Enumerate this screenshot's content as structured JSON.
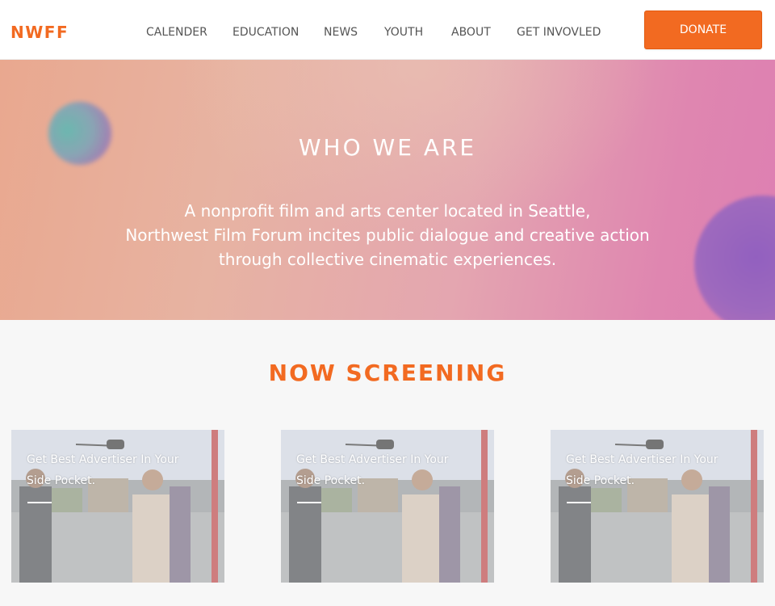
{
  "header": {
    "logo": "NWFF",
    "nav": [
      "CALENDER",
      "EDUCATION",
      "NEWS",
      "YOUTH",
      "ABOUT",
      "GET INVOVLED"
    ],
    "donate_label": "DONATE"
  },
  "hero": {
    "title": "WHO WE ARE",
    "description_lines": [
      "A nonprofit film and arts center located in Seattle,",
      "Northwest Film Forum incites public dialogue and creative action",
      "through collective cinematic experiences."
    ]
  },
  "screening": {
    "title": "NOW SCREENING",
    "cards": [
      {
        "line1": "Get Best Advertiser In Your",
        "line2": "Side Pocket."
      },
      {
        "line1": "Get Best Advertiser In Your",
        "line2": "Side Pocket."
      },
      {
        "line1": "Get Best Advertiser In Your",
        "line2": "Side Pocket."
      }
    ]
  },
  "colors": {
    "accent": "#f26a21",
    "nav_text": "#555555",
    "page_bg": "#f7f7f7"
  }
}
